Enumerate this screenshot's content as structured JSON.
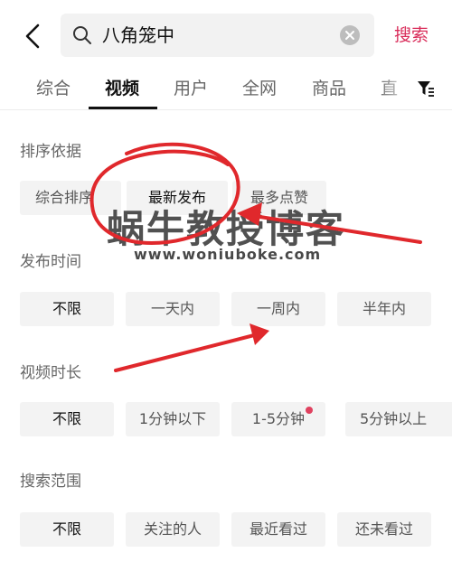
{
  "header": {
    "query": "八角笼中",
    "search_button": "搜索"
  },
  "tabs": [
    {
      "label": "综合"
    },
    {
      "label": "视频"
    },
    {
      "label": "用户"
    },
    {
      "label": "全网"
    },
    {
      "label": "商品"
    },
    {
      "label": "直"
    }
  ],
  "active_tab": "视频",
  "sections": {
    "sort": {
      "title": "排序依据",
      "options": [
        "综合排序",
        "最新发布",
        "最多点赞"
      ]
    },
    "publish_time": {
      "title": "发布时间",
      "options": [
        "不限",
        "一天内",
        "一周内",
        "半年内"
      ]
    },
    "duration": {
      "title": "视频时长",
      "options": [
        "不限",
        "1分钟以下",
        "1-5分钟",
        "5分钟以上"
      ]
    },
    "scope": {
      "title": "搜索范围",
      "options": [
        "不限",
        "关注的人",
        "最近看过",
        "还未看过"
      ]
    }
  },
  "watermark": {
    "main": "蜗牛教授博客",
    "url": "www.woniuboke.com"
  },
  "colors": {
    "accent": "#d92c5a",
    "annotation_red": "#e0282c",
    "chip_bg": "#f3f3f3"
  }
}
